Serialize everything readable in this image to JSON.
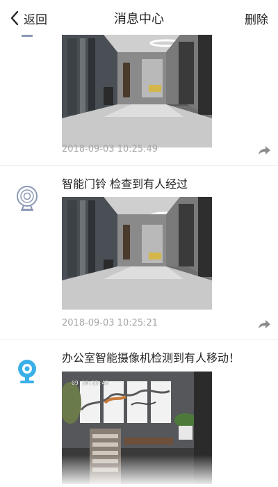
{
  "nav": {
    "back_label": "返回",
    "title": "消息中心",
    "delete_label": "删除"
  },
  "messages": [
    {
      "title": "",
      "time": "2018-09-03 10:25:49",
      "device_icon": "doorbell-camera-icon",
      "snapshot": "lobby-corridor-snapshot"
    },
    {
      "title": "智能门铃 检查到有人经过",
      "time": "2018-09-03 10:25:21",
      "device_icon": "doorbell-camera-icon",
      "snapshot": "lobby-corridor-snapshot"
    },
    {
      "title": "办公室智能摄像机检测到有人移动！",
      "time": "",
      "device_icon": "webcam-icon",
      "snapshot": "office-wall-paintings-snapshot",
      "osd_text": "09 10:23:43"
    }
  ],
  "colors": {
    "title_text": "#222222",
    "timestamp_text": "#a5a5a5",
    "separator": "#ececec",
    "webcam_accent": "#3bb0e8",
    "doorbell_icon": "#8a98b3"
  }
}
